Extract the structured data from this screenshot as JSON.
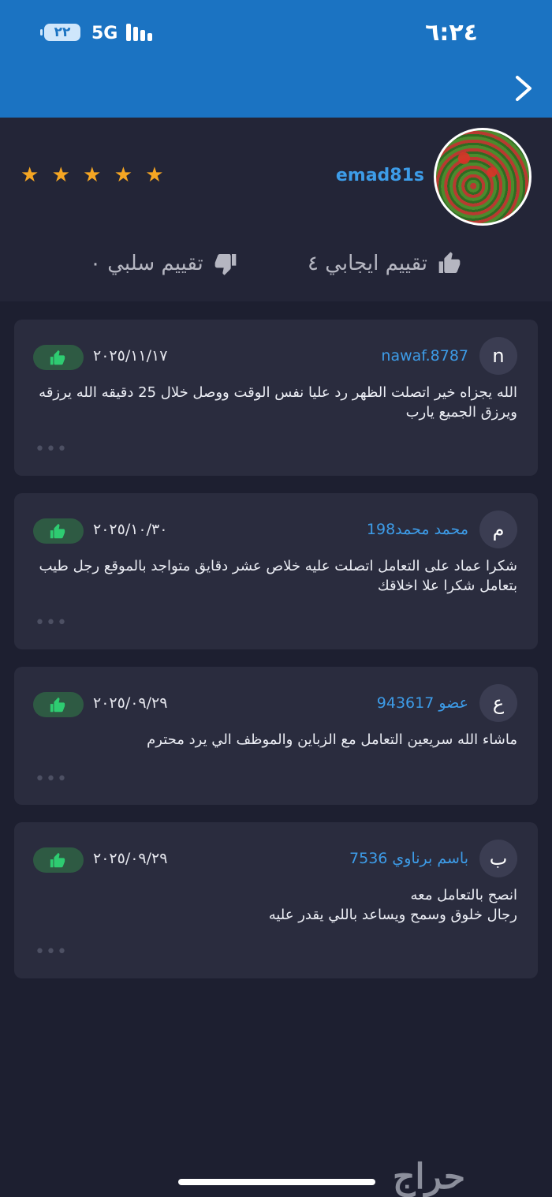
{
  "status_bar": {
    "time": "٦:٢٤",
    "battery": "٢٢",
    "network": "5G"
  },
  "profile": {
    "username": "emad81s",
    "stars": "★ ★ ★ ★ ★",
    "rating": 5,
    "positive": "تقييم ايجابي ٤",
    "negative": "تقييم سلبي ٠"
  },
  "reviews": [
    {
      "initial": "n",
      "name": "nawaf.8787",
      "date": "٢٠٢٥/١١/١٧",
      "text": "الله يجزاه خير اتصلت الظهر رد عليا نفس الوقت ووصل خلال 25 دقيقه الله يرزقه ويرزق الجميع يارب",
      "dots": "•••"
    },
    {
      "initial": "م",
      "name": "محمد محمد198",
      "date": "٢٠٢٥/١٠/٣٠",
      "text": "شكرا عماد على التعامل اتصلت عليه خلاص عشر دقايق متواجد بالموقع رجل طيب بتعامل شكرا علا اخلاقك",
      "dots": "•••"
    },
    {
      "initial": "ع",
      "name": "عضو 943617",
      "date": "٢٠٢٥/٠٩/٢٩",
      "text": "ماشاء الله سريعين التعامل مع الزباين والموظف الي يرد محترم",
      "dots": "•••"
    },
    {
      "initial": "ب",
      "name": "باسم برناوي 7536",
      "date": "٢٠٢٥/٠٩/٢٩",
      "text": "انصح بالتعامل معه\nرجال خلوق وسمح ويساعد باللي يقدر عليه",
      "dots": "•••"
    }
  ],
  "logo": "حراج",
  "colors": {
    "header": "#1b73c2",
    "link": "#3d9ce8",
    "like": "#2ecc71",
    "star": "#f5a623"
  }
}
